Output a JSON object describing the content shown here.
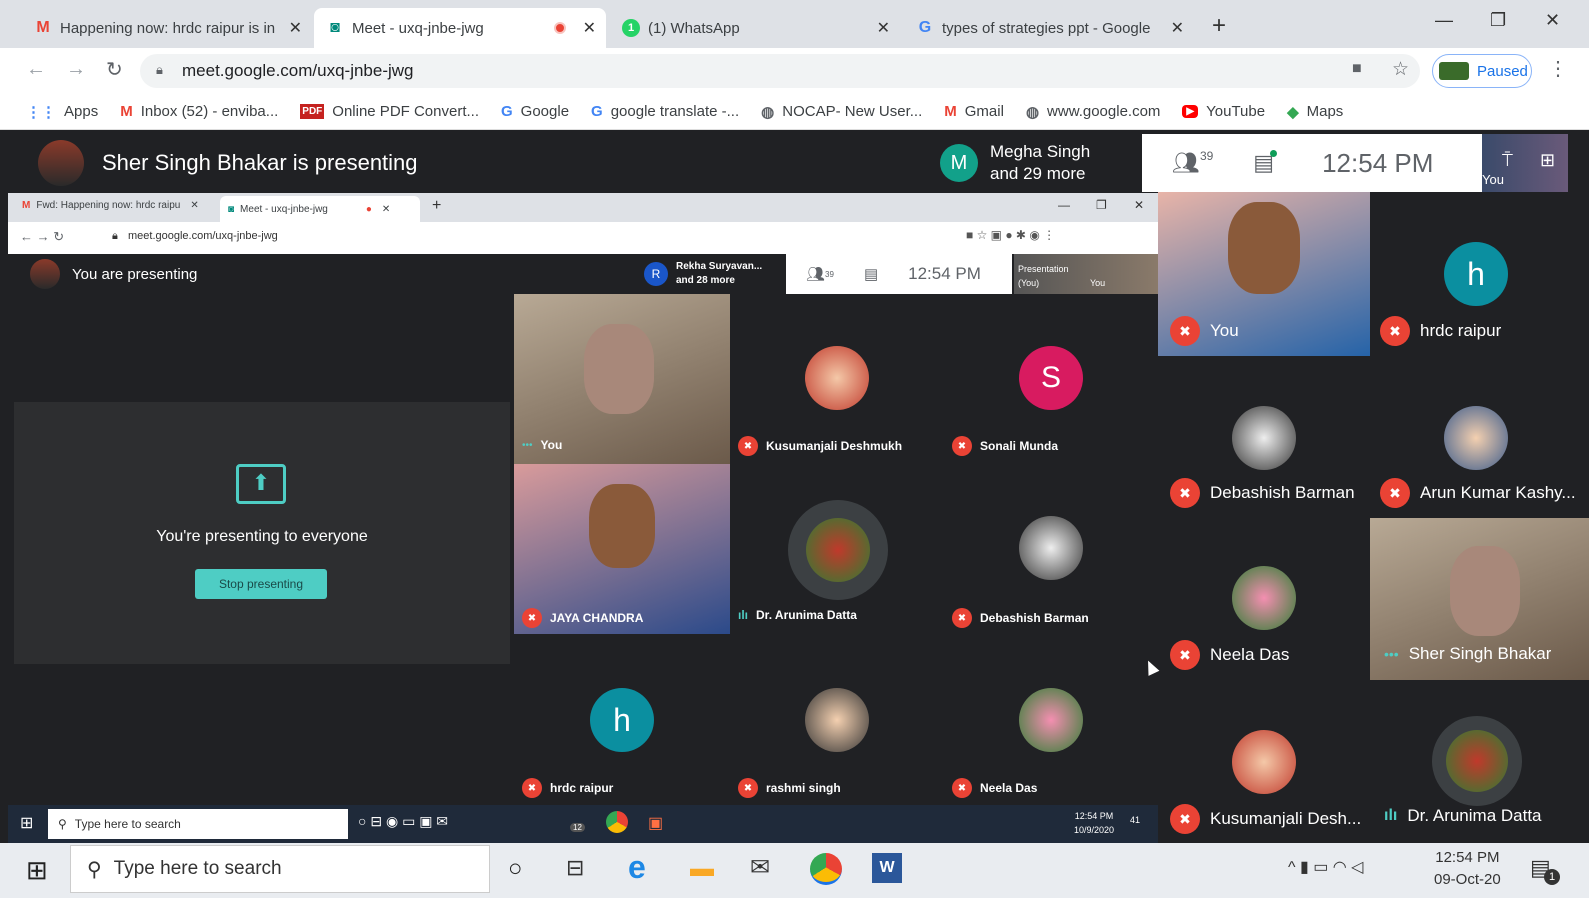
{
  "browser": {
    "tabs": [
      {
        "icon": "gmail-icon",
        "title": "Happening now: hrdc raipur is in"
      },
      {
        "icon": "meet-icon",
        "title": "Meet - uxq-jnbe-jwg"
      },
      {
        "icon": "whatsapp-icon",
        "title": "(1) WhatsApp"
      },
      {
        "icon": "google-icon",
        "title": "types of strategies ppt - Google"
      }
    ],
    "url": "meet.google.com/uxq-jnbe-jwg",
    "paused_label": "Paused",
    "bookmarks": [
      "Apps",
      "Inbox (52) - enviba...",
      "Online PDF Convert...",
      "Google",
      "google translate -...",
      "NOCAP- New User...",
      "Gmail",
      "www.google.com",
      "YouTube",
      "Maps"
    ]
  },
  "meet": {
    "presenter_text": "Sher Singh Bhakar is presenting",
    "chip_initial": "M",
    "chip_line1": "Megha Singh",
    "chip_line2": "and 29 more",
    "people_count": "39",
    "time": "12:54 PM",
    "you_label": "You",
    "sidebar": [
      {
        "name": "You",
        "type": "video"
      },
      {
        "name": "hrdc raipur",
        "initial": "h",
        "color": "#0b8fa0"
      },
      {
        "name": "Debashish Barman",
        "type": "avatar"
      },
      {
        "name": "Arun Kumar Kashy...",
        "type": "avatar"
      },
      {
        "name": "Neela Das",
        "type": "avatar"
      },
      {
        "name": "Sher Singh Bhakar",
        "type": "video"
      },
      {
        "name": "Kusumanjali Desh...",
        "type": "avatar"
      },
      {
        "name": "Dr. Arunima Datta",
        "type": "avatar"
      }
    ]
  },
  "inner": {
    "tabs": [
      "Fwd: Happening now: hrdc raipu",
      "Meet - uxq-jnbe-jwg"
    ],
    "url": "meet.google.com/uxq-jnbe-jwg",
    "presenting_text": "You are presenting",
    "chip_initial": "R",
    "chip_line1": "Rekha Suryavan...",
    "chip_line2": "and 28 more",
    "people_count": "39",
    "time": "12:54 PM",
    "presentation_label": "Presentation",
    "presentation_sub": "(You)",
    "thumb_you": "You",
    "share_message": "You're presenting to everyone",
    "stop_button": "Stop presenting",
    "grid": [
      {
        "name": "You"
      },
      {
        "name": "Kusumanjali Deshmukh"
      },
      {
        "name": "Sonali Munda",
        "initial": "S",
        "color": "#d81b60"
      },
      {
        "name": "JAYA CHANDRA"
      },
      {
        "name": "Dr. Arunima Datta"
      },
      {
        "name": "Debashish Barman"
      },
      {
        "name": "hrdc raipur",
        "initial": "h",
        "color": "#0b8fa0"
      },
      {
        "name": "rashmi singh"
      },
      {
        "name": "Neela Das"
      }
    ],
    "taskbar_search": "Type here to search",
    "taskbar_time": "12:54 PM",
    "taskbar_date": "10/9/2020",
    "taskbar_badge": "41",
    "taskbar_count": "12"
  },
  "taskbar": {
    "search": "Type here to search",
    "time": "12:54 PM",
    "date": "09-Oct-20",
    "notif": "1"
  }
}
